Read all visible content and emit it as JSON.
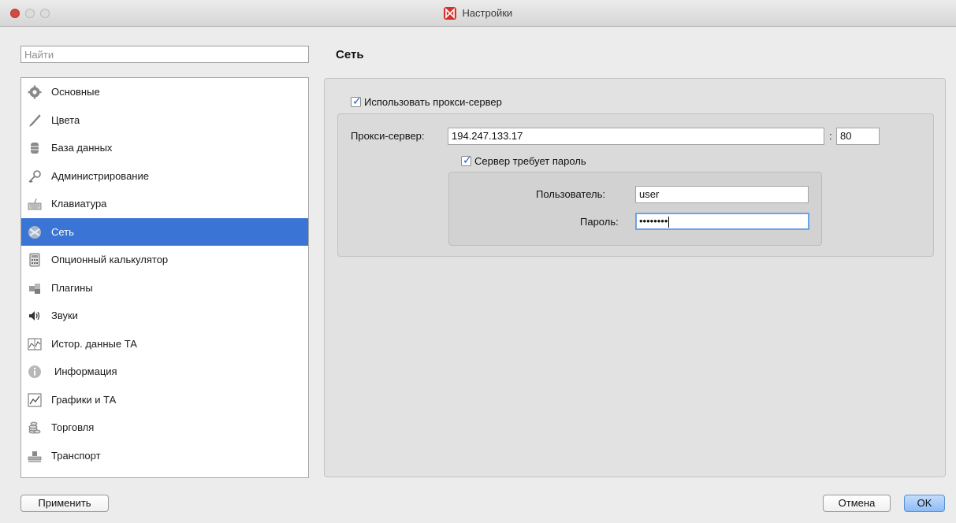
{
  "window": {
    "title": "Настройки"
  },
  "search": {
    "placeholder": "Найти",
    "value": ""
  },
  "sidebar": {
    "items": [
      {
        "label": "Основные",
        "icon": "gear-icon"
      },
      {
        "label": "Цвета",
        "icon": "brush-icon"
      },
      {
        "label": "База данных",
        "icon": "database-icon"
      },
      {
        "label": "Администрирование",
        "icon": "key-icon"
      },
      {
        "label": "Клавиатура",
        "icon": "keyboard-icon"
      },
      {
        "label": "Сеть",
        "icon": "network-icon",
        "selected": true
      },
      {
        "label": "Опционный калькулятор",
        "icon": "calculator-icon"
      },
      {
        "label": "Плагины",
        "icon": "puzzle-icon"
      },
      {
        "label": "Звуки",
        "icon": "speaker-icon"
      },
      {
        "label": "Истор. данные ТА",
        "icon": "history-chart-icon"
      },
      {
        "label": "Информация",
        "icon": "info-icon"
      },
      {
        "label": "Графики и ТА",
        "icon": "line-chart-icon"
      },
      {
        "label": "Торговля",
        "icon": "coins-icon"
      },
      {
        "label": "Транспорт",
        "icon": "transport-icon"
      }
    ]
  },
  "main": {
    "section_title": "Сеть",
    "use_proxy": {
      "label": "Использовать прокси-сервер",
      "checked": true
    },
    "proxy_label": "Прокси-сервер:",
    "proxy_host": "194.247.133.17",
    "port_separator": ":",
    "proxy_port": "80",
    "auth": {
      "label": "Сервер требует пароль",
      "checked": true
    },
    "user_label": "Пользователь:",
    "user_value": "user",
    "password_label": "Пароль:",
    "password_value": "••••••••"
  },
  "buttons": {
    "apply": "Применить",
    "cancel": "Отмена",
    "ok": "OK"
  },
  "colors": {
    "selection": "#3a75d5",
    "check": "#1e5fc4",
    "focus": "#6aa3e8"
  }
}
